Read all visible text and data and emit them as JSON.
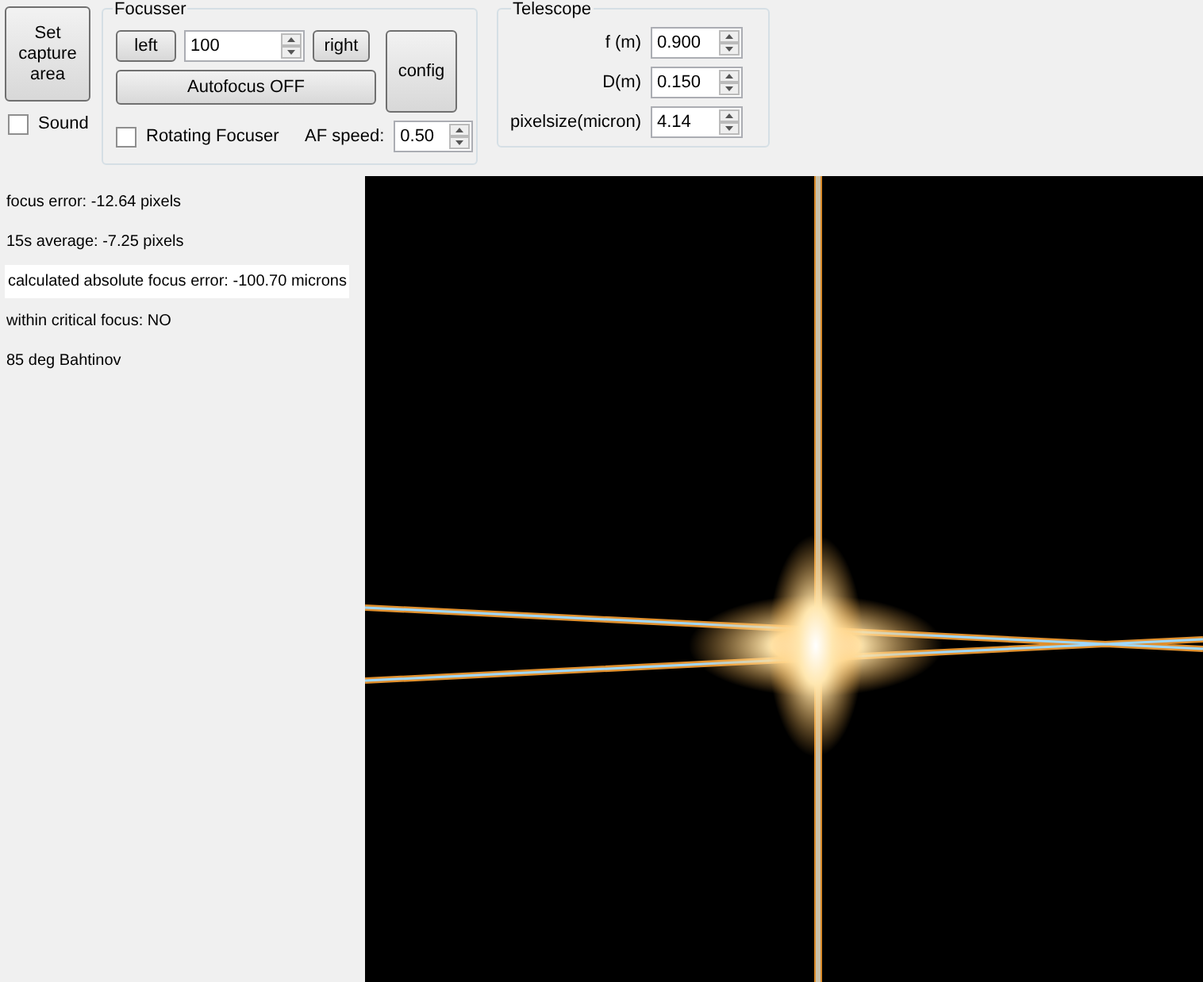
{
  "capture_button": "Set capture area",
  "sound": {
    "label": "Sound",
    "checked": false
  },
  "focusser": {
    "title": "Focusser",
    "left_button": "left",
    "step": "100",
    "right_button": "right",
    "autofocus_button": "Autofocus OFF",
    "config_button": "config",
    "rotating": {
      "label": "Rotating Focuser",
      "checked": false
    },
    "af_speed_label": "AF speed:",
    "af_speed": "0.50"
  },
  "telescope": {
    "title": "Telescope",
    "fields": [
      {
        "label": "f (m)",
        "value": "0.900"
      },
      {
        "label": "D(m)",
        "value": "0.150"
      },
      {
        "label": "pixelsize(micron)",
        "value": "4.14"
      }
    ]
  },
  "readouts": [
    {
      "text": "focus error: -12.64 pixels",
      "highlighted": false
    },
    {
      "text": "15s average: -7.25 pixels",
      "highlighted": false
    },
    {
      "text": "calculated absolute focus error: -100.70 microns",
      "highlighted": true
    },
    {
      "text": "within critical focus: NO",
      "highlighted": false
    },
    {
      "text": "85 deg Bahtinov",
      "highlighted": false
    }
  ]
}
